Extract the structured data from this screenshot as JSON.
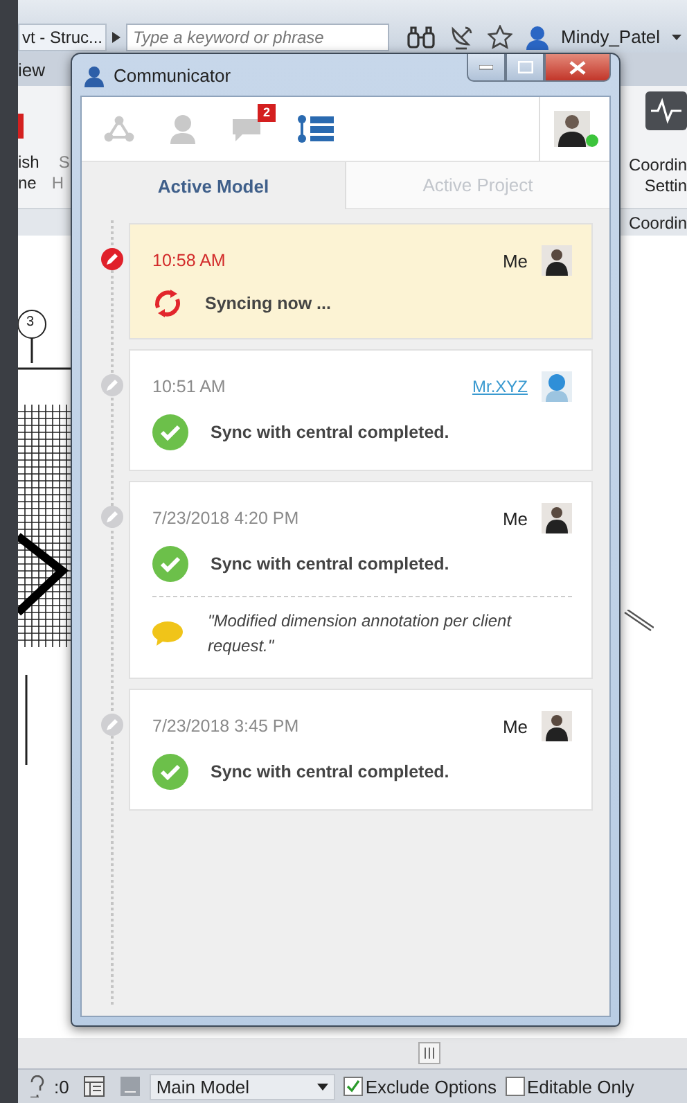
{
  "app_bar": {
    "file_title": "vt - Struc...",
    "search": {
      "placeholder": "Type a keyword or phrase"
    },
    "user": "Mindy_Patel"
  },
  "ribbon": {
    "tab": "iew",
    "left_labels": [
      "ish",
      "ne"
    ],
    "cut_labels": [
      "S",
      "H"
    ],
    "right_labels": [
      "Coordin",
      "Settin"
    ],
    "panel_title": "Coordin"
  },
  "canvas": {
    "grid_bubble": "3"
  },
  "communicator": {
    "title": "Communicator",
    "toolbar": [
      {
        "kind": "network",
        "selected": false
      },
      {
        "kind": "user",
        "selected": false
      },
      {
        "kind": "chat",
        "selected": false,
        "badge": "2"
      },
      {
        "kind": "timeline",
        "selected": true
      }
    ],
    "presence": {
      "online": true
    },
    "tabs": [
      {
        "label": "Active Model",
        "selected": true
      },
      {
        "label": "Active Project",
        "selected": false
      }
    ],
    "entries": [
      {
        "kind": "syncing",
        "time": "10:58 AM",
        "author": "Me",
        "author_link": false,
        "message": "Syncing now ..."
      },
      {
        "kind": "done",
        "time": "10:51 AM",
        "author": "Mr.XYZ",
        "author_link": true,
        "message": "Sync with central completed."
      },
      {
        "kind": "done",
        "time": "7/23/2018 4:20 PM",
        "author": "Me",
        "author_link": false,
        "message": "Sync with central completed.",
        "comment": "\"Modified dimension annotation per client request.\""
      },
      {
        "kind": "done",
        "time": "7/23/2018 3:45 PM",
        "author": "Me",
        "author_link": false,
        "message": "Sync with central completed."
      }
    ]
  },
  "status_bar": {
    "filter_count": ":0",
    "workset": "Main Model",
    "options": [
      {
        "label": "Exclude Options",
        "checked": true
      },
      {
        "label": "Editable Only",
        "checked": false
      }
    ]
  }
}
